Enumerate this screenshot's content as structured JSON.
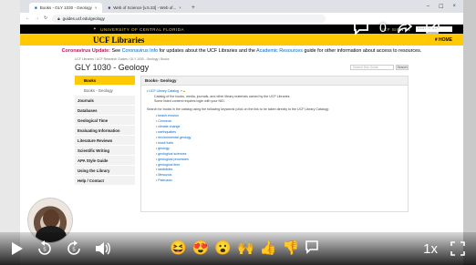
{
  "browser": {
    "tabs": [
      {
        "label": "Books - GLY 1030 - Geology",
        "active": true
      },
      {
        "label": "Web of Science [v.5.33] - Web of...",
        "active": false
      }
    ],
    "new_tab": "+",
    "window_controls": [
      "–",
      "☐",
      "×"
    ],
    "url": "guides.ucf.edu/geology"
  },
  "ucf_header": {
    "university": "UNIVERSITY OF CENTRAL FLORIDA",
    "right_link": "UCF SIGN IN",
    "search_placeholder": "Search UCF"
  },
  "library_banner": {
    "title": "UCF Libraries",
    "home": "HOME"
  },
  "covid_notice": {
    "alert": "Coronavirus Update:",
    "pre": " See ",
    "link1": "Coronavirus Info",
    "mid": " for updates about the UCF Libraries and the ",
    "link2": "Academic Resources",
    "post": " guide for other information about access to resources."
  },
  "guide": {
    "breadcrumb": "UCF Libraries / UCF Research Guides / GLY 1030 - Geology / Books",
    "title": "GLY 1030 - Geology",
    "search_placeholder": "Search this Guide",
    "search_button": "Search"
  },
  "nav": {
    "items": [
      {
        "label": "Books",
        "state": "active"
      },
      {
        "label": "Books - Geology",
        "state": "sub"
      },
      {
        "label": "Journals",
        "state": ""
      },
      {
        "label": "Databases",
        "state": ""
      },
      {
        "label": "Geological Time",
        "state": ""
      },
      {
        "label": "Evaluating Information",
        "state": ""
      },
      {
        "label": "Literature Reviews",
        "state": ""
      },
      {
        "label": "Scientific Writing",
        "state": ""
      },
      {
        "label": "APA Style Guide",
        "state": ""
      },
      {
        "label": "Using the Library",
        "state": ""
      },
      {
        "label": "Help / Contact",
        "state": ""
      }
    ]
  },
  "content": {
    "heading": "Books- Geology",
    "catalog_link": "UCF Library Catalog",
    "catalog_desc1": "Catalog of the books, media, journals, and other library materials owned by the UCF Libraries.",
    "catalog_desc2": "Some listed content requires login with your NID.",
    "search_instructions": "Search for books in the catalog using the following keywords (click on the link to be taken directly to the UCF Library Catalog):",
    "keywords": [
      "beach erosion",
      "Cenozoic",
      "climate change",
      "earthquakes",
      "environmental geology",
      "fossil fuels",
      "geology",
      "geological sciences",
      "geological processes",
      "geological time",
      "landslides",
      "Mesozoic",
      "Paleozoic"
    ]
  },
  "video_overlay": {
    "top_count": "0",
    "speed": "1x"
  }
}
